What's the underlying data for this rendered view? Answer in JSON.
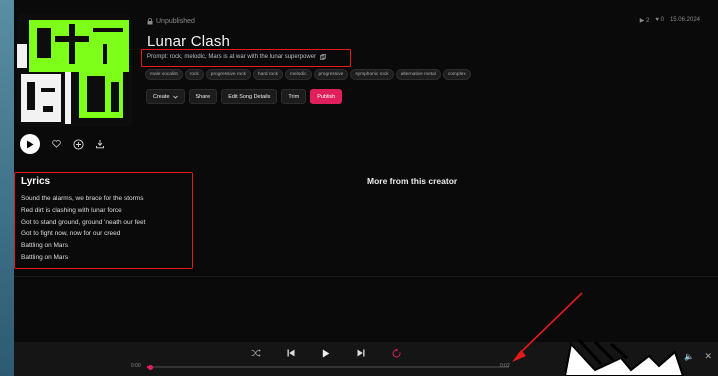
{
  "song": {
    "status": "Unpublished",
    "title": "Lunar Clash",
    "prompt": "Prompt: rock, melodic, Mars is at war with the lunar superpower",
    "tags": [
      "male vocalist",
      "rock",
      "progressive rock",
      "hard rock",
      "melodic",
      "progressive",
      "symphonic rock",
      "alternative metal",
      "complex"
    ],
    "stats": {
      "plays": "2",
      "likes": "0",
      "date": "15.06.2024"
    }
  },
  "actions": {
    "create": "Create",
    "share": "Share",
    "edit": "Edit Song Details",
    "trim": "Trim",
    "publish": "Publish"
  },
  "lyrics": {
    "heading": "Lyrics",
    "lines": [
      "Sound the alarms, we brace for the storms",
      "Red dirt is clashing with lunar force",
      "Got to stand ground, ground 'neath our feet",
      "Got to fight now, now for our creed",
      "Battling on Mars",
      "Battling on Mars"
    ]
  },
  "more_heading": "More from this creator",
  "player": {
    "time_current": "0:00",
    "time_total": "0:02",
    "progress": 0.01
  },
  "colors": {
    "accent": "#e0205c",
    "highlight": "#e21a1a",
    "cover_green": "#7dff1a"
  }
}
